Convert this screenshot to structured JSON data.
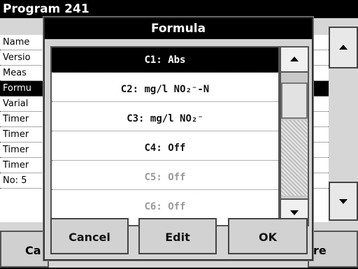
{
  "background": {
    "title": "Program    241",
    "rows": [
      "Name",
      "Versio",
      "Meas",
      "Formu",
      "Varial",
      "Timer",
      "Timer",
      "Timer",
      "Timer",
      "No: 5"
    ],
    "selected_row": 3,
    "bottom_left_label": "Ca",
    "bottom_right_label": "re"
  },
  "dialog": {
    "title": "Formula",
    "options": [
      {
        "label": "C1: Abs",
        "state": "selected"
      },
      {
        "label": "C2: mg/l NO₂⁻-N",
        "state": "enabled"
      },
      {
        "label": "C3: mg/l NO₂⁻",
        "state": "enabled"
      },
      {
        "label": "C4: Off",
        "state": "enabled"
      },
      {
        "label": "C5: Off",
        "state": "disabled"
      },
      {
        "label": "C6: Off",
        "state": "disabled"
      }
    ],
    "buttons": {
      "cancel": "Cancel",
      "edit": "Edit",
      "ok": "OK"
    }
  }
}
